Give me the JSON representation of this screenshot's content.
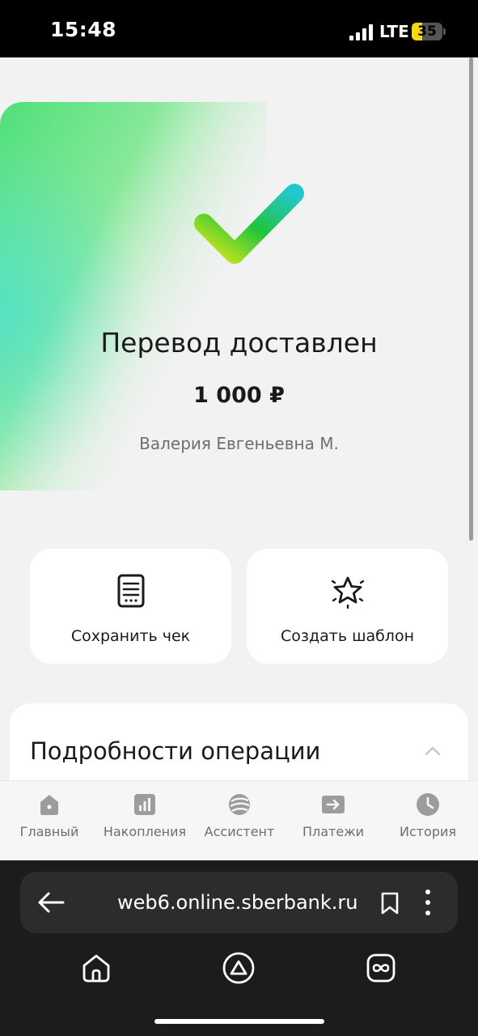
{
  "status_bar": {
    "time": "15:48",
    "network": "LTE",
    "battery": "35",
    "battery_level": 0.35
  },
  "result": {
    "title": "Перевод доставлен",
    "amount": "1 000 ₽",
    "recipient": "Валерия Евгеньевна М.",
    "icon": "check-icon"
  },
  "actions": [
    {
      "label": "Сохранить чек",
      "icon": "receipt-icon"
    },
    {
      "label": "Создать шаблон",
      "icon": "star-icon"
    }
  ],
  "details": {
    "title": "Подробности операции",
    "icon": "chevron-up-icon"
  },
  "tabbar": {
    "items": [
      {
        "label": "Главный",
        "icon": "home-icon"
      },
      {
        "label": "Накопления",
        "icon": "savings-chart-icon"
      },
      {
        "label": "Ассистент",
        "icon": "assistant-icon"
      },
      {
        "label": "Платежи",
        "icon": "payments-arrow-icon"
      },
      {
        "label": "История",
        "icon": "history-clock-icon"
      }
    ]
  },
  "browser": {
    "url": "web6.online.sberbank.ru",
    "nav": [
      {
        "icon": "browser-home-icon"
      },
      {
        "icon": "alice-icon"
      },
      {
        "icon": "tabs-icon"
      }
    ]
  },
  "colors": {
    "accent": "#21a038",
    "page_bg": "#f2f2f2",
    "card_bg": "#ffffff"
  }
}
